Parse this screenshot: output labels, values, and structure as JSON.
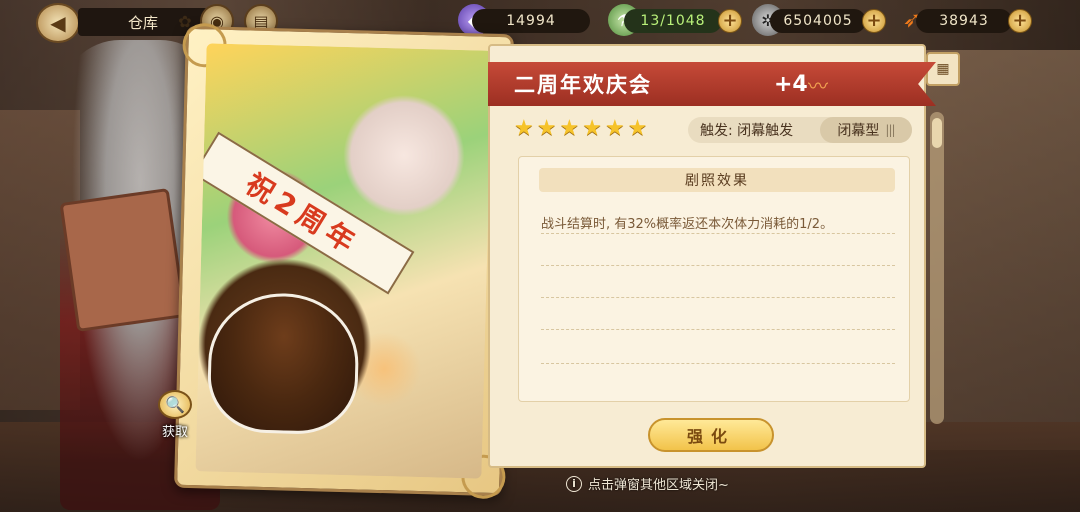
{
  "top_bar": {
    "title": "仓库",
    "resources": [
      {
        "icon": "purple-gem-icon",
        "value": "14994"
      },
      {
        "icon": "stamina-potion-icon",
        "value": "13/1048"
      },
      {
        "icon": "gear-coin-icon",
        "value": "6504005"
      },
      {
        "icon": "carrot-icon",
        "value": "38943"
      }
    ]
  },
  "card": {
    "banner_text": "祝2周年",
    "get_label": "获取"
  },
  "detail": {
    "name": "二周年欢庆会",
    "level": "+4",
    "stars": 6,
    "trigger_label": "触发: 闭幕触发",
    "type_label": "闭幕型",
    "effect_header": "剧照效果",
    "effect_text": "战斗结算时, 有32%概率返还本次体力消耗的1/2。",
    "enhance_button": "强化"
  },
  "hint": "点击弹窗其他区域关闭~",
  "colors": {
    "ribbon": "#c64a38",
    "star": "#f6c32a",
    "button": "#f2c34a"
  }
}
